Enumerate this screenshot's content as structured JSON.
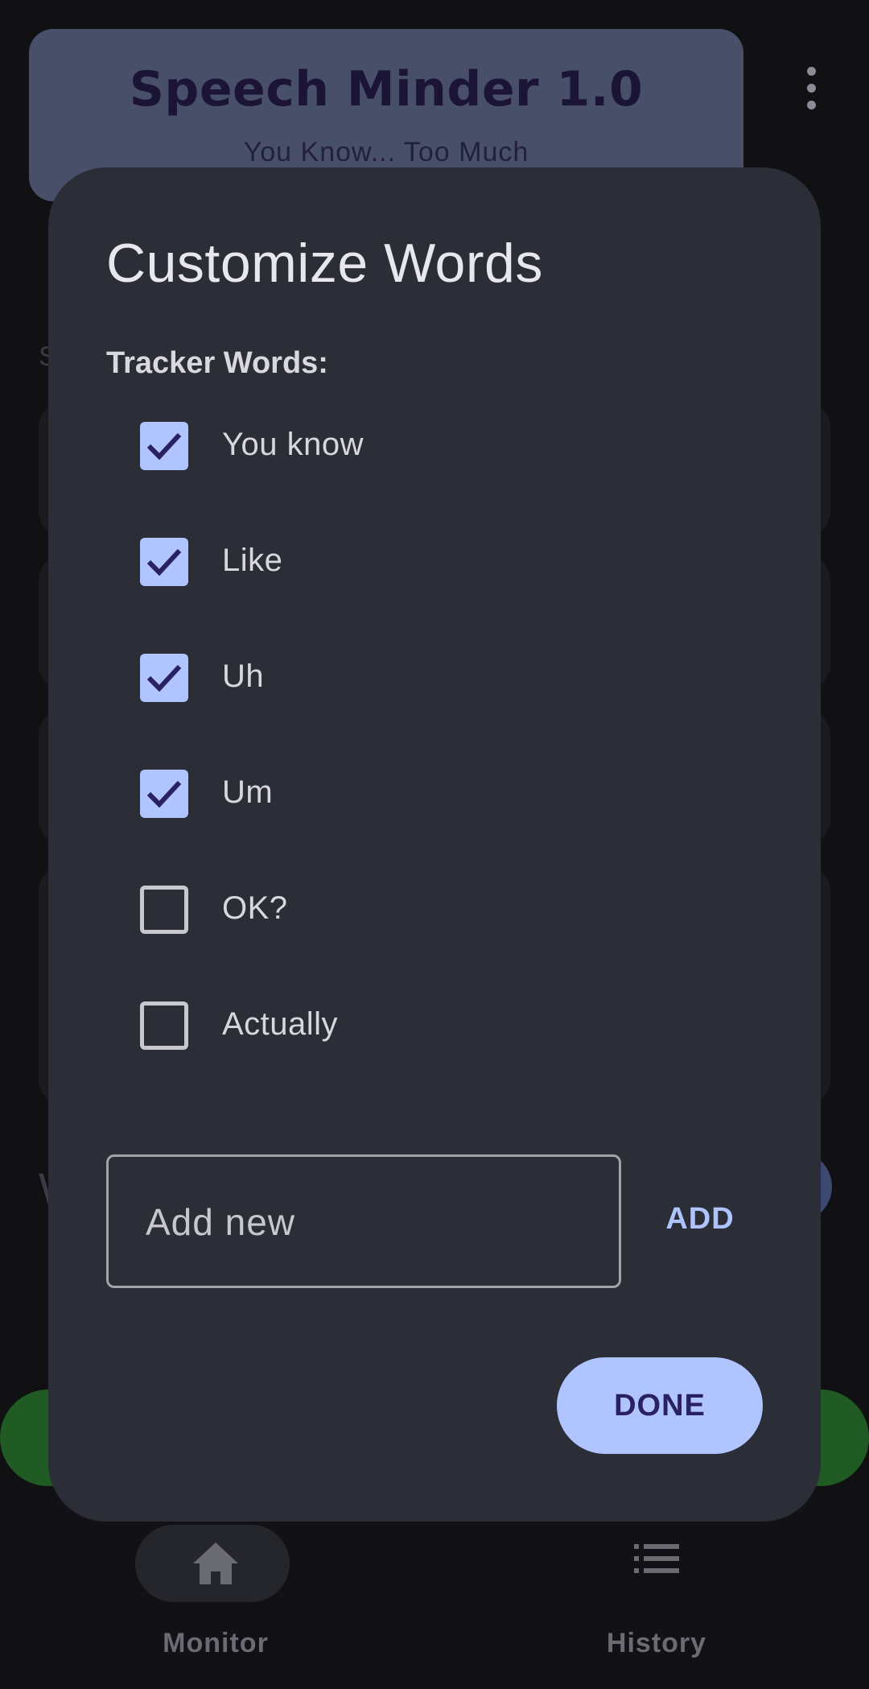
{
  "header": {
    "title": "Speech Minder 1.0",
    "subtitle": "You Know... Too Much"
  },
  "dialog": {
    "title": "Customize Words",
    "section_label": "Tracker Words:",
    "words": [
      {
        "label": "You know",
        "checked": true
      },
      {
        "label": "Like",
        "checked": true
      },
      {
        "label": "Uh",
        "checked": true
      },
      {
        "label": "Um",
        "checked": true
      },
      {
        "label": "OK?",
        "checked": false
      },
      {
        "label": "Actually",
        "checked": false
      }
    ],
    "add_field": {
      "placeholder": "Add new"
    },
    "add_label": "ADD",
    "done_label": "DONE"
  },
  "bottom_nav": {
    "items": [
      {
        "label": "Monitor",
        "icon": "home-icon",
        "selected": true
      },
      {
        "label": "History",
        "icon": "list-icon",
        "selected": false
      }
    ]
  },
  "colors": {
    "dialog_bg": "#2b2d37",
    "accent": "#b0c4ff",
    "accent_text": "#2a2160",
    "header_card": "#475068"
  }
}
